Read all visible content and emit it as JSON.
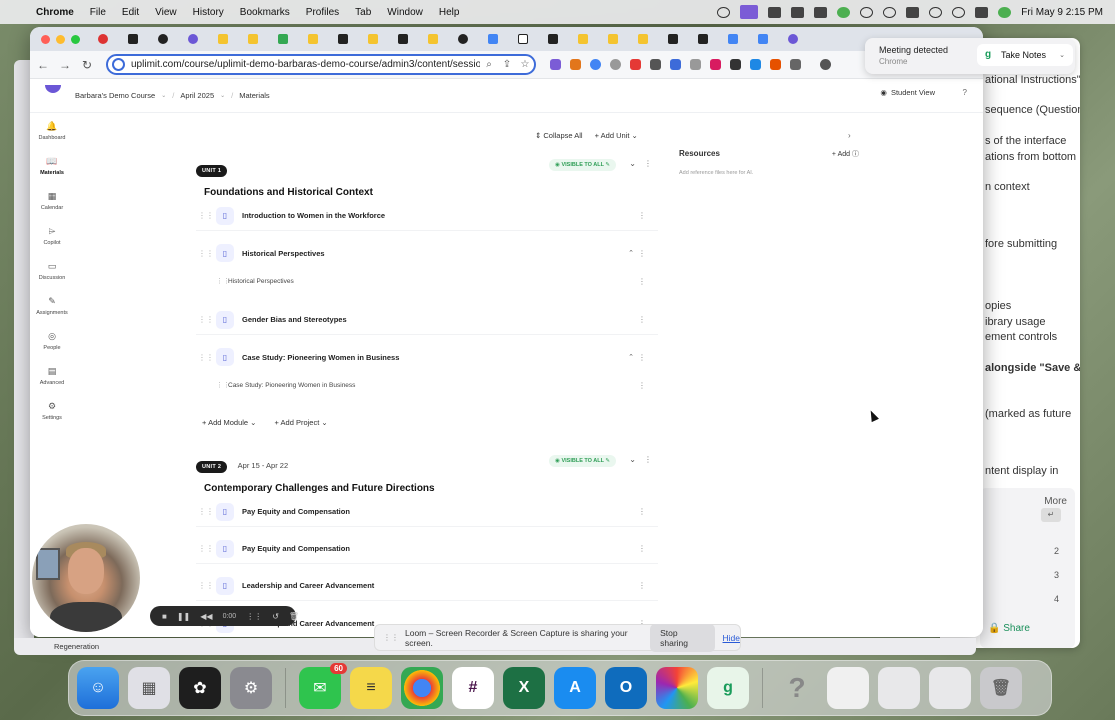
{
  "menubar": {
    "app": "Chrome",
    "items": [
      "File",
      "Edit",
      "View",
      "History",
      "Bookmarks",
      "Profiles",
      "Tab",
      "Window",
      "Help"
    ],
    "clock": "Fri May 9  2:15 PM"
  },
  "browser": {
    "url": "uplimit.com/course/uplimit-demo-barbaras-demo-course/admin3/content/session_..."
  },
  "breadcrumb": {
    "course": "Barbara's Demo Course",
    "term": "April 2025",
    "section": "Materials"
  },
  "header": {
    "student_view": "Student View",
    "help": "?"
  },
  "sidenav": [
    {
      "label": "Dashboard",
      "icon": "🔔"
    },
    {
      "label": "Materials",
      "icon": "📖"
    },
    {
      "label": "Calendar",
      "icon": "▦"
    },
    {
      "label": "Copilot",
      "icon": "⌲"
    },
    {
      "label": "Discussion",
      "icon": "▭"
    },
    {
      "label": "Assignments",
      "icon": "✎"
    },
    {
      "label": "People",
      "icon": "◎"
    },
    {
      "label": "Advanced",
      "icon": "▤"
    },
    {
      "label": "Settings",
      "icon": "⚙"
    }
  ],
  "main_toolbar": {
    "collapse_all": "Collapse All",
    "add_unit": "Add Unit"
  },
  "units": [
    {
      "badge": "UNIT 1",
      "date": "",
      "visibility": "VISIBLE TO ALL",
      "title": "Foundations and Historical Context",
      "lessons": [
        {
          "title": "Introduction to Women in the Workforce"
        },
        {
          "title": "Historical Perspectives",
          "sub": "Historical Perspectives"
        },
        {
          "title": "Gender Bias and Stereotypes"
        },
        {
          "title": "Case Study: Pioneering Women in Business",
          "sub": "Case Study: Pioneering Women in Business"
        }
      ],
      "add_module": "Add Module",
      "add_project": "Add Project"
    },
    {
      "badge": "UNIT 2",
      "date": "Apr 15 - Apr 22",
      "visibility": "VISIBLE TO ALL",
      "title": "Contemporary Challenges and Future Directions",
      "lessons": [
        {
          "title": "Pay Equity and Compensation"
        },
        {
          "title": "Pay Equity and Compensation"
        },
        {
          "title": "Leadership and Career Advancement"
        },
        {
          "title": "Leadership and Career Advancement"
        }
      ]
    }
  ],
  "resources": {
    "title": "Resources",
    "add": "Add",
    "hint": "Add reference files here for AI."
  },
  "back_window": {
    "lines": [
      "ational Instructions\"",
      "sequence (Question",
      "s of the interface",
      "ations from bottom",
      "n context",
      "fore submitting",
      "opies",
      "ibrary usage",
      "ement controls",
      "alongside \"Save &",
      "(marked as future",
      "ntent display in"
    ],
    "more": "More",
    "nums": [
      "2",
      "3",
      "4"
    ],
    "share": "Share"
  },
  "meeting_toast": {
    "title": "Meeting detected",
    "subtitle": "Chrome",
    "button": "Take Notes"
  },
  "recorder": {
    "time": "0:00"
  },
  "loom": {
    "message": "Loom – Screen Recorder & Screen Capture is sharing your screen.",
    "stop": "Stop sharing",
    "hide": "Hide"
  },
  "regen": "Regeneration",
  "dock": {
    "messages_badge": "60"
  },
  "colors": {
    "accent": "#3d6bd9",
    "brand": "#6b57d6",
    "visible_green": "#2f9e56"
  }
}
